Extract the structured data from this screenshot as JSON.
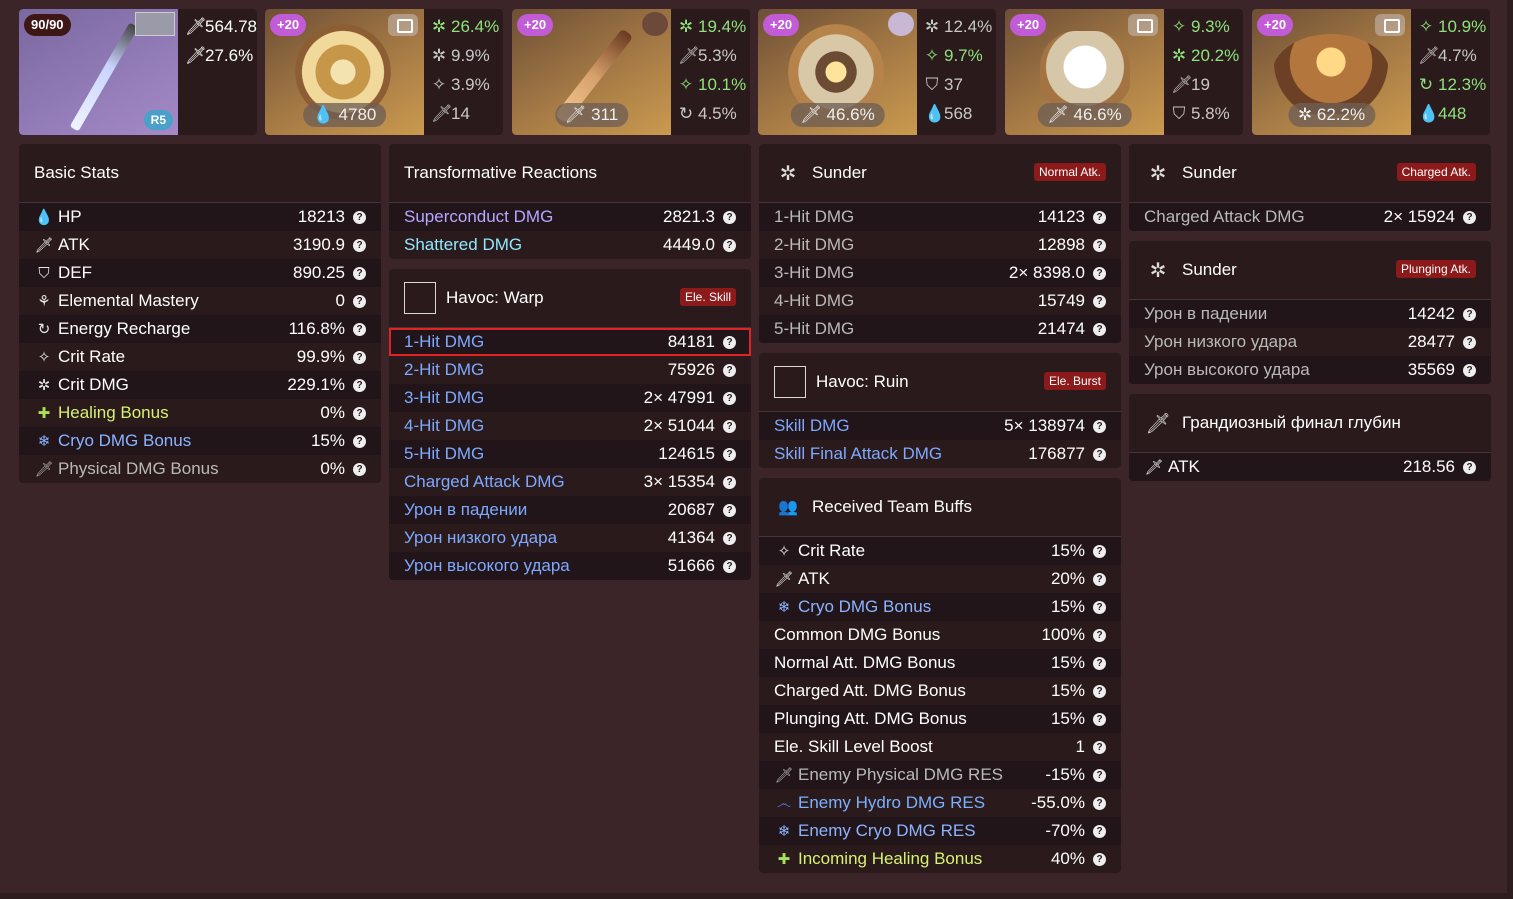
{
  "weapon": {
    "level": "90/90",
    "refine": "R5",
    "atk": "564.78",
    "sub": "27.6%"
  },
  "artifacts": [
    {
      "level": "+20",
      "main": "4780",
      "subs": [
        "26.4%",
        "9.9%",
        "3.9%",
        "14"
      ]
    },
    {
      "level": "+20",
      "main": "311",
      "subs": [
        "19.4%",
        "5.3%",
        "10.1%",
        "4.5%"
      ]
    },
    {
      "level": "+20",
      "main": "46.6%",
      "subs": [
        "12.4%",
        "9.7%",
        "37",
        "568"
      ]
    },
    {
      "level": "+20",
      "main": "46.6%",
      "subs": [
        "9.3%",
        "20.2%",
        "19",
        "5.8%"
      ]
    },
    {
      "level": "+20",
      "main": "62.2%",
      "subs": [
        "10.9%",
        "4.7%",
        "12.3%",
        "448"
      ]
    }
  ],
  "basic": {
    "title": "Basic Stats",
    "rows": [
      {
        "label": "HP",
        "value": "18213"
      },
      {
        "label": "ATK",
        "value": "3190.9"
      },
      {
        "label": "DEF",
        "value": "890.25"
      },
      {
        "label": "Elemental Mastery",
        "value": "0"
      },
      {
        "label": "Energy Recharge",
        "value": "116.8%"
      },
      {
        "label": "Crit Rate",
        "value": "99.9%"
      },
      {
        "label": "Crit DMG",
        "value": "229.1%"
      },
      {
        "label": "Healing Bonus",
        "value": "0%"
      },
      {
        "label": "Cryo DMG Bonus",
        "value": "15%"
      },
      {
        "label": "Physical DMG Bonus",
        "value": "0%"
      }
    ]
  },
  "transform": {
    "title": "Transformative Reactions",
    "rows": [
      {
        "label": "Superconduct DMG",
        "value": "2821.3"
      },
      {
        "label": "Shattered DMG",
        "value": "4449.0"
      }
    ]
  },
  "warp": {
    "title": "Havoc: Warp",
    "tag": "Ele. Skill",
    "rows": [
      {
        "label": "1-Hit DMG",
        "value": "84181"
      },
      {
        "label": "2-Hit DMG",
        "value": "75926"
      },
      {
        "label": "3-Hit DMG",
        "value": "2× 47991"
      },
      {
        "label": "4-Hit DMG",
        "value": "2× 51044"
      },
      {
        "label": "5-Hit DMG",
        "value": "124615"
      },
      {
        "label": "Charged Attack DMG",
        "value": "3× 15354"
      },
      {
        "label": "Урон в падении",
        "value": "20687"
      },
      {
        "label": "Урон низкого удара",
        "value": "41364"
      },
      {
        "label": "Урон высокого удара",
        "value": "51666"
      }
    ]
  },
  "sunder_normal": {
    "title": "Sunder",
    "tag": "Normal Atk.",
    "rows": [
      {
        "label": "1-Hit DMG",
        "value": "14123"
      },
      {
        "label": "2-Hit DMG",
        "value": "12898"
      },
      {
        "label": "3-Hit DMG",
        "value": "2× 8398.0"
      },
      {
        "label": "4-Hit DMG",
        "value": "15749"
      },
      {
        "label": "5-Hit DMG",
        "value": "21474"
      }
    ]
  },
  "ruin": {
    "title": "Havoc: Ruin",
    "tag": "Ele. Burst",
    "rows": [
      {
        "label": "Skill DMG",
        "value": "5× 138974"
      },
      {
        "label": "Skill Final Attack DMG",
        "value": "176877"
      }
    ]
  },
  "buffs": {
    "title": "Received Team Buffs",
    "rows": [
      {
        "label": "Crit Rate",
        "value": "15%"
      },
      {
        "label": "ATK",
        "value": "20%"
      },
      {
        "label": "Cryo DMG Bonus",
        "value": "15%"
      },
      {
        "label": "Common DMG Bonus",
        "value": "100%"
      },
      {
        "label": "Normal Att. DMG Bonus",
        "value": "15%"
      },
      {
        "label": "Charged Att. DMG Bonus",
        "value": "15%"
      },
      {
        "label": "Plunging Att. DMG Bonus",
        "value": "15%"
      },
      {
        "label": "Ele. Skill Level Boost",
        "value": "1"
      },
      {
        "label": "Enemy Physical DMG RES",
        "value": "-15%"
      },
      {
        "label": "Enemy Hydro DMG RES",
        "value": "-55.0%"
      },
      {
        "label": "Enemy Cryo DMG RES",
        "value": "-70%"
      },
      {
        "label": "Incoming Healing Bonus",
        "value": "40%"
      }
    ]
  },
  "sunder_charged": {
    "title": "Sunder",
    "tag": "Charged Atk.",
    "rows": [
      {
        "label": "Charged Attack DMG",
        "value": "2× 15924"
      }
    ]
  },
  "sunder_plunge": {
    "title": "Sunder",
    "tag": "Plunging Atk.",
    "rows": [
      {
        "label": "Урон в падении",
        "value": "14242"
      },
      {
        "label": "Урон низкого удара",
        "value": "28477"
      },
      {
        "label": "Урон высокого удара",
        "value": "35569"
      }
    ]
  },
  "finale": {
    "title": "Грандиозный финал глубин",
    "rows": [
      {
        "label": "ATK",
        "value": "218.56"
      }
    ]
  },
  "help_glyph": "?"
}
